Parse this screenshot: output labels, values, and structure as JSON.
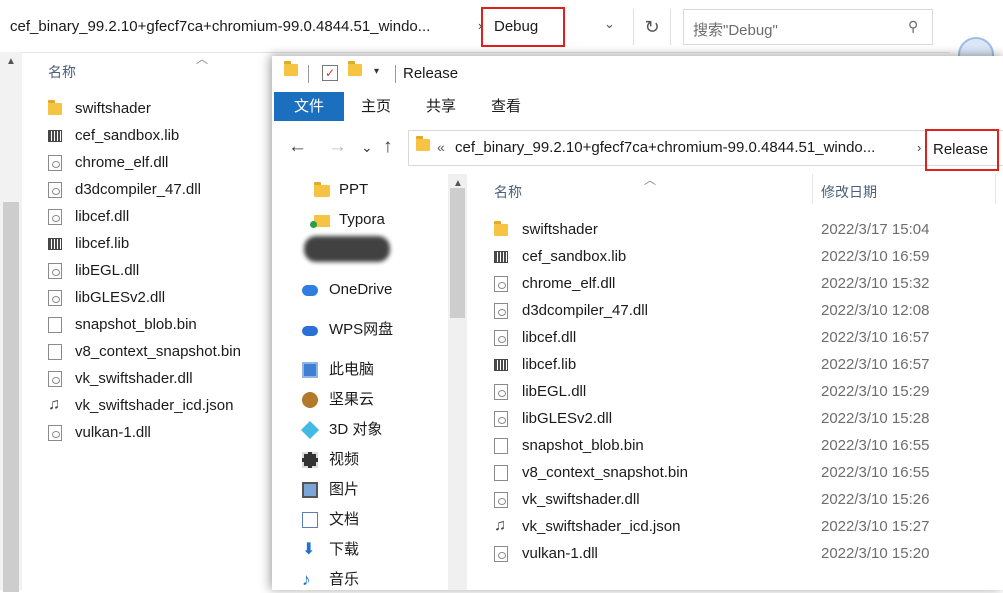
{
  "back_window": {
    "address_path": "cef_binary_99.2.10+gfecf7ca+chromium-99.0.4844.51_windo...",
    "breadcrumb_sep": "›",
    "current_folder": "Debug",
    "dropdown_glyph": "⌄",
    "refresh_glyph": "↻",
    "search_placeholder": "搜索\"Debug\"",
    "search_glyph": "⚲",
    "column_name": "名称",
    "files": [
      {
        "name": "swiftshader",
        "icon": "folder-icon"
      },
      {
        "name": "cef_sandbox.lib",
        "icon": "lib-file-icon"
      },
      {
        "name": "chrome_elf.dll",
        "icon": "dll-file-icon"
      },
      {
        "name": "d3dcompiler_47.dll",
        "icon": "dll-file-icon"
      },
      {
        "name": "libcef.dll",
        "icon": "dll-file-icon"
      },
      {
        "name": "libcef.lib",
        "icon": "lib-file-icon"
      },
      {
        "name": "libEGL.dll",
        "icon": "dll-file-icon"
      },
      {
        "name": "libGLESv2.dll",
        "icon": "dll-file-icon"
      },
      {
        "name": "snapshot_blob.bin",
        "icon": "doc-file-icon"
      },
      {
        "name": "v8_context_snapshot.bin",
        "icon": "doc-file-icon"
      },
      {
        "name": "vk_swiftshader.dll",
        "icon": "dll-file-icon"
      },
      {
        "name": "vk_swiftshader_icd.json",
        "icon": "json-file-icon"
      },
      {
        "name": "vulkan-1.dll",
        "icon": "dll-file-icon"
      }
    ]
  },
  "front_window": {
    "title": "Release",
    "ribbon_tabs": {
      "file": "文件",
      "home": "主页",
      "share": "共享",
      "view": "查看"
    },
    "nav": {
      "back": "←",
      "forward": "→",
      "recent": "⌄",
      "up": "↑"
    },
    "address_chevron": "«",
    "address_path": "cef_binary_99.2.10+gfecf7ca+chromium-99.0.4844.51_windo...",
    "breadcrumb_sep": "›",
    "current_folder": "Release",
    "nav_pane": [
      {
        "label": "PPT",
        "icon": "folder-icon"
      },
      {
        "label": "Typora",
        "icon": "folder-icon"
      },
      {
        "label": "OneDrive",
        "icon": "onedrive-icon"
      },
      {
        "label": "WPS网盘",
        "icon": "wps-cloud-icon"
      },
      {
        "label": "此电脑",
        "icon": "computer-icon"
      },
      {
        "label": "坚果云",
        "icon": "nutstore-icon"
      },
      {
        "label": "3D 对象",
        "icon": "3d-objects-icon"
      },
      {
        "label": "视频",
        "icon": "videos-icon"
      },
      {
        "label": "图片",
        "icon": "pictures-icon"
      },
      {
        "label": "文档",
        "icon": "documents-icon"
      },
      {
        "label": "下载",
        "icon": "downloads-icon"
      },
      {
        "label": "音乐",
        "icon": "music-icon"
      }
    ],
    "columns": {
      "name": "名称",
      "date": "修改日期"
    },
    "files": [
      {
        "name": "swiftshader",
        "date": "2022/3/17 15:04",
        "icon": "folder-icon"
      },
      {
        "name": "cef_sandbox.lib",
        "date": "2022/3/10 16:59",
        "icon": "lib-file-icon"
      },
      {
        "name": "chrome_elf.dll",
        "date": "2022/3/10 15:32",
        "icon": "dll-file-icon"
      },
      {
        "name": "d3dcompiler_47.dll",
        "date": "2022/3/10 12:08",
        "icon": "dll-file-icon"
      },
      {
        "name": "libcef.dll",
        "date": "2022/3/10 16:57",
        "icon": "dll-file-icon"
      },
      {
        "name": "libcef.lib",
        "date": "2022/3/10 16:57",
        "icon": "lib-file-icon"
      },
      {
        "name": "libEGL.dll",
        "date": "2022/3/10 15:29",
        "icon": "dll-file-icon"
      },
      {
        "name": "libGLESv2.dll",
        "date": "2022/3/10 15:28",
        "icon": "dll-file-icon"
      },
      {
        "name": "snapshot_blob.bin",
        "date": "2022/3/10 16:55",
        "icon": "doc-file-icon"
      },
      {
        "name": "v8_context_snapshot.bin",
        "date": "2022/3/10 16:55",
        "icon": "doc-file-icon"
      },
      {
        "name": "vk_swiftshader.dll",
        "date": "2022/3/10 15:26",
        "icon": "dll-file-icon"
      },
      {
        "name": "vk_swiftshader_icd.json",
        "date": "2022/3/10 15:27",
        "icon": "json-file-icon"
      },
      {
        "name": "vulkan-1.dll",
        "date": "2022/3/10 15:20",
        "icon": "dll-file-icon"
      }
    ]
  },
  "colors": {
    "highlight": "#e0201c",
    "accent": "#1a6fbf",
    "folder": "#f6c343"
  }
}
